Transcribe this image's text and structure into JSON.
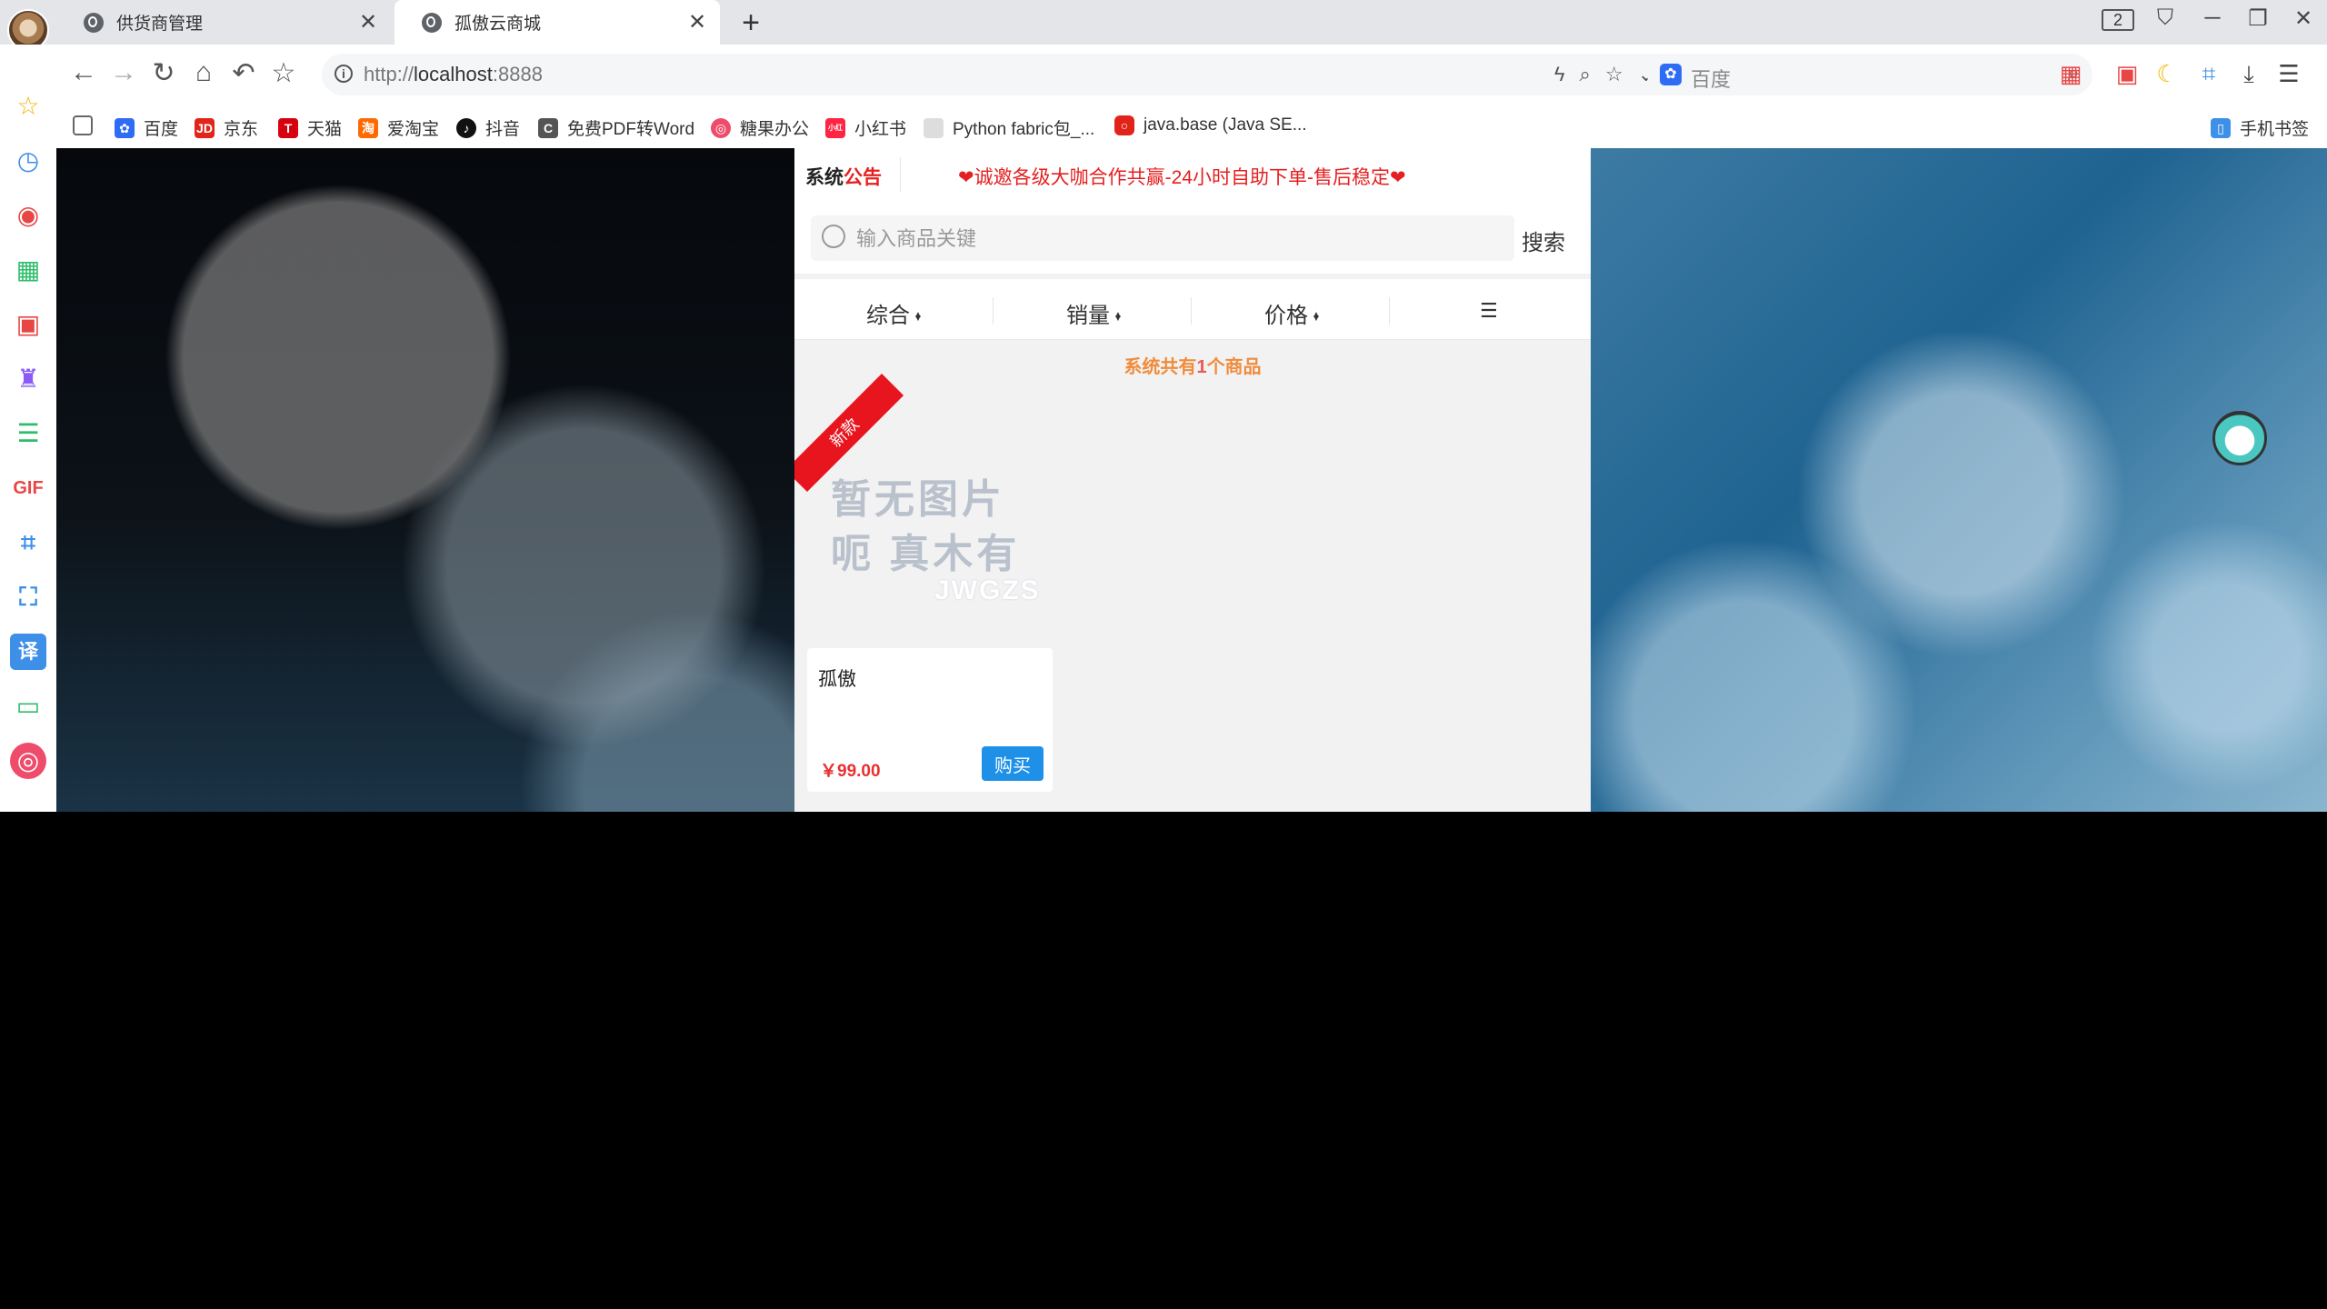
{
  "browser": {
    "tabs": [
      {
        "title": "供货商管理",
        "active": false
      },
      {
        "title": "孤傲云商城",
        "active": true
      }
    ],
    "tab_count": "2",
    "url_prefix": "http://",
    "url_host": "localhost",
    "url_port": ":8888",
    "search_engine_placeholder": "百度",
    "bookmarks": [
      {
        "label": "百度",
        "icon": "baidu-icon",
        "color": "#2f6cf5"
      },
      {
        "label": "京东",
        "icon": "jd-icon",
        "color": "#e1251b"
      },
      {
        "label": "天猫",
        "icon": "tmall-icon",
        "color": "#d7000f"
      },
      {
        "label": "爱淘宝",
        "icon": "aitaobao-icon",
        "color": "#ff6a00"
      },
      {
        "label": "抖音",
        "icon": "douyin-icon",
        "color": "#111111"
      },
      {
        "label": "免费PDF转Word",
        "icon": "pdf-convert-icon",
        "color": "#555555"
      },
      {
        "label": "糖果办公",
        "icon": "candy-office-icon",
        "color": "#ef4b6a"
      },
      {
        "label": "小红书",
        "icon": "xiaohongshu-icon",
        "color": "#ff2442"
      },
      {
        "label": "Python fabric包_...",
        "icon": "page-icon",
        "color": "#dddddd"
      },
      {
        "label": "java.base (Java SE...",
        "icon": "oracle-icon",
        "color": "#e2231a"
      }
    ],
    "mobile_bookmarks": "手机书签"
  },
  "shop": {
    "notice_title_black": "系统",
    "notice_title_red": "公告",
    "notice_text": "❤诚邀各级大咖合作共赢-24小时自助下单-售后稳定❤",
    "search_placeholder": "输入商品关键",
    "search_button": "搜索",
    "sort": {
      "comprehensive": "综合",
      "sales": "销量",
      "price": "价格"
    },
    "count_prefix": "系统共有",
    "count_value": "1",
    "count_suffix": "个商品",
    "products": [
      {
        "badge": "新款",
        "placeholder_line1": "暂无图片",
        "placeholder_line2": "呃 真木有",
        "placeholder_mark": "JWGZS",
        "name": "孤傲",
        "price": "￥99.00",
        "buy_label": "购买"
      }
    ]
  },
  "colors": {
    "accent_red": "#e52020",
    "count_orange": "#f08c3c",
    "buy_blue": "#1e90e8"
  }
}
